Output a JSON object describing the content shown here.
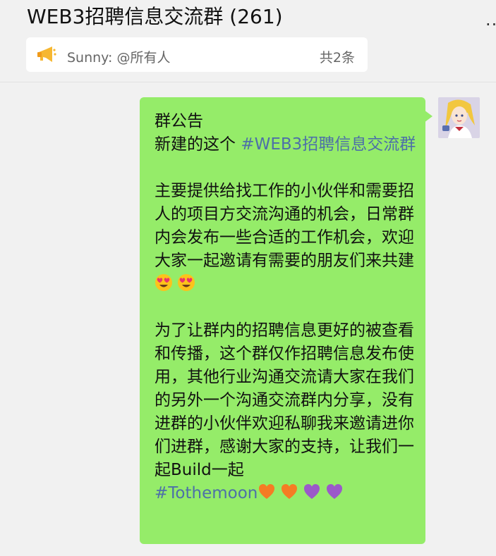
{
  "header": {
    "title": "WEB3招聘信息交流群 (261)",
    "more_label": "..",
    "notice": {
      "icon": "megaphone-icon",
      "text": "Sunny: @所有人",
      "count": "共2条"
    }
  },
  "message": {
    "avatar": "user-avatar",
    "line1": "群公告",
    "line2_prefix": "新建的这个 ",
    "line2_tag": "#WEB3招聘信息交流群",
    "para2": "主要提供给找工作的小伙伴和需要招人的项目方交流沟通的机会，日常群内会发布一些合适的工作机会，欢迎大家一起邀请有需要的朋友们来共建",
    "para3": "为了让群内的招聘信息更好的被查看和传播，这个群仅作招聘信息发布使用，其他行业沟通交流请大家在我们的另外一个沟通交流群内分享，没有进群的小伙伴欢迎私聊我来邀请进你们进群，感谢大家的支持，让我们一起Build一起",
    "tag2": "#Tothemoon",
    "emoji_names": [
      "heart-eyes-emoji",
      "orange-heart-emoji",
      "purple-heart-emoji"
    ]
  },
  "colors": {
    "bubble": "#95ec69",
    "hashtag": "#4d70a8",
    "background": "#f1f1f1"
  }
}
